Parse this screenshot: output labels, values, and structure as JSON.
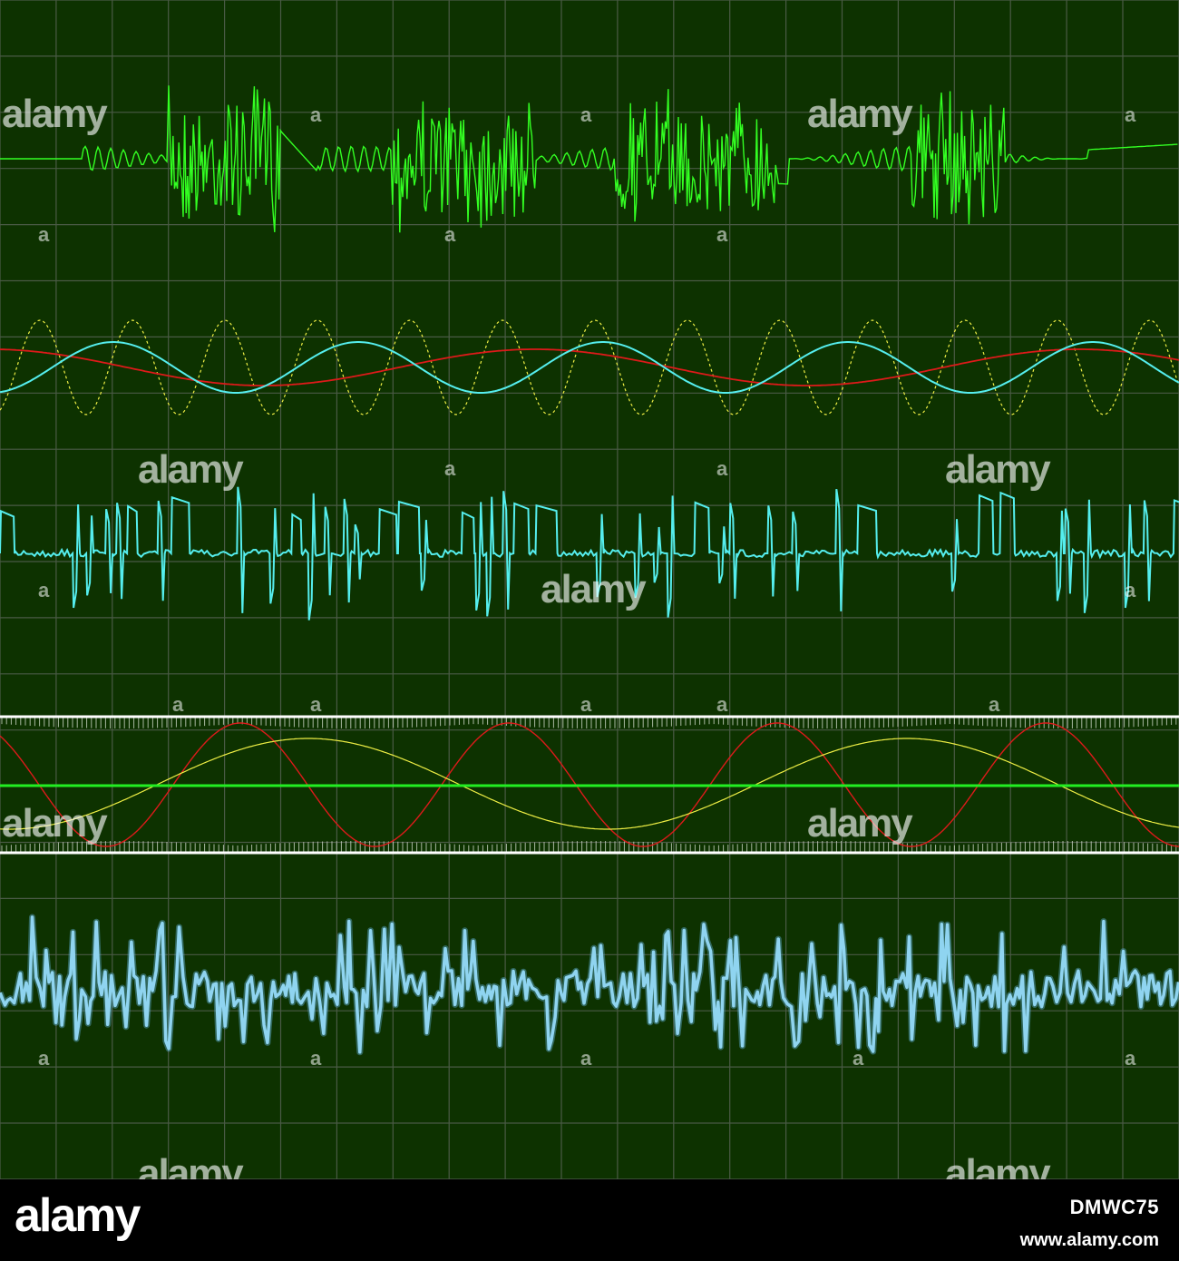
{
  "colors": {
    "background": "#0d3200",
    "grid": "#4a5a45",
    "green_wave": "#33ff22",
    "cyan_wave": "#55eeee",
    "red_wave": "#dd1a1a",
    "yellow_dotted": "#eeee44",
    "noise_wave": "#8fd4f0",
    "frame": "#ffffff",
    "center_line": "#22ee22",
    "footer": "#000000"
  },
  "watermark": {
    "text": "alamy",
    "letter": "a"
  },
  "footer": {
    "logo": "alamy",
    "image_id": "DMWC75",
    "url": "www.alamy.com"
  }
}
